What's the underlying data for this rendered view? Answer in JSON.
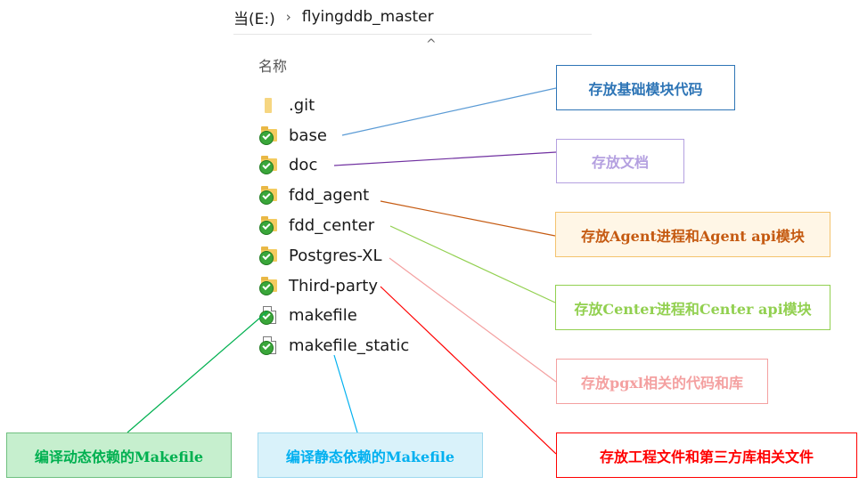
{
  "explorer": {
    "breadcrumb": {
      "drive": "当(E:)",
      "separator": "›",
      "folder": "flyingddb_master"
    },
    "sort_caret": "^",
    "column_header": "名称",
    "items": [
      {
        "name": ".git",
        "icon": "folder-icon"
      },
      {
        "name": "base",
        "icon": "folder-synced-icon"
      },
      {
        "name": "doc",
        "icon": "folder-synced-icon"
      },
      {
        "name": "fdd_agent",
        "icon": "folder-synced-icon"
      },
      {
        "name": "fdd_center",
        "icon": "folder-synced-icon"
      },
      {
        "name": "Postgres-XL",
        "icon": "folder-synced-icon"
      },
      {
        "name": "Third-party",
        "icon": "folder-synced-icon"
      },
      {
        "name": "makefile",
        "icon": "file-synced-icon"
      },
      {
        "name": "makefile_static",
        "icon": "file-synced-icon"
      }
    ]
  },
  "callouts": {
    "base": {
      "text": "存放基础模块代码",
      "color": "#2e75b6",
      "border": "#2e75b6",
      "bg": "#ffffff"
    },
    "doc": {
      "text": "存放文档",
      "color": "#b4a0e0",
      "border": "#b4a0e0",
      "bg": "#ffffff"
    },
    "agent": {
      "text": "存放Agent进程和Agent api模块",
      "color": "#c55a11",
      "border": "#f4c36e",
      "bg": "#fff6e6"
    },
    "center": {
      "text": "存放Center进程和Center api模块",
      "color": "#92d050",
      "border": "#92d050",
      "bg": "#ffffff"
    },
    "pgxl": {
      "text": "存放pgxl相关的代码和库",
      "color": "#f4a0a0",
      "border": "#f4a0a0",
      "bg": "#ffffff"
    },
    "third": {
      "text": "存放工程文件和第三方库相关文件",
      "color": "#ff0000",
      "border": "#ff0000",
      "bg": "#ffffff"
    },
    "makefile": {
      "text": "编译动态依赖的Makefile",
      "color": "#00b050",
      "border": "#70c080",
      "bg": "#c6efce"
    },
    "makefile_static": {
      "text": "编译静态依赖的Makefile",
      "color": "#00b0f0",
      "border": "#9fd9ef",
      "bg": "#d9f2fa"
    }
  }
}
